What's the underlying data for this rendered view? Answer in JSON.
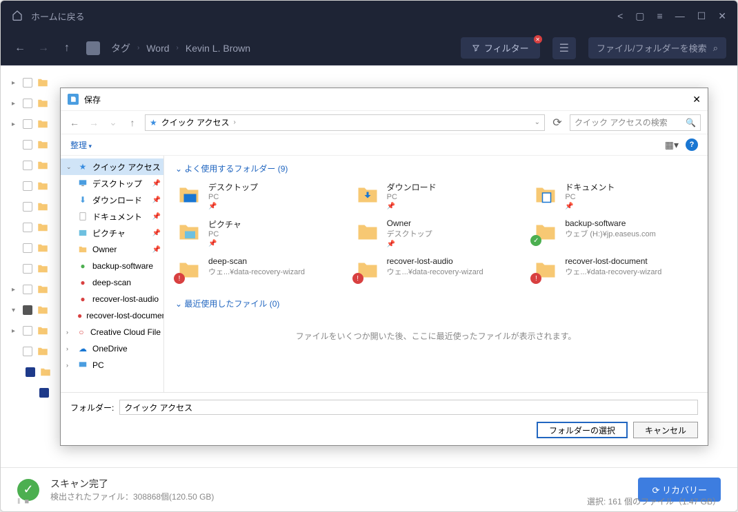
{
  "titlebar": {
    "home": "ホームに戻る"
  },
  "toolbar": {
    "tag": "タグ",
    "crumb1": "Word",
    "crumb2": "Kevin L. Brown",
    "filter": "フィルター",
    "search_placeholder": "ファイル/フォルダーを検索"
  },
  "dialog": {
    "title": "保存",
    "path": "クイック アクセス",
    "search_placeholder": "クイック アクセスの検索",
    "organize": "整理",
    "sidebar": {
      "quick_access": "クイック アクセス",
      "desktop": "デスクトップ",
      "downloads": "ダウンロード",
      "documents": "ドキュメント",
      "pictures": "ピクチャ",
      "owner": "Owner",
      "backup": "backup-software",
      "deepscan": "deep-scan",
      "recover_audio": "recover-lost-audio",
      "recover_doc": "recover-lost-document",
      "creative": "Creative Cloud File",
      "onedrive": "OneDrive",
      "pc": "PC"
    },
    "section_freq": "よく使用するフォルダー (9)",
    "section_recent": "最近使用したファイル (0)",
    "recent_empty": "ファイルをいくつか開いた後、ここに最近使ったファイルが表示されます。",
    "folders": [
      {
        "name": "デスクトップ",
        "loc": "PC",
        "pinned": true,
        "icon": "desktop"
      },
      {
        "name": "ダウンロード",
        "loc": "PC",
        "pinned": true,
        "icon": "download"
      },
      {
        "name": "ドキュメント",
        "loc": "PC",
        "pinned": true,
        "icon": "document"
      },
      {
        "name": "ピクチャ",
        "loc": "PC",
        "pinned": true,
        "icon": "picture"
      },
      {
        "name": "Owner",
        "loc": "デスクトップ",
        "pinned": true,
        "icon": "folder"
      },
      {
        "name": "backup-software",
        "loc": "ウェブ (H:)¥jp.easeus.com",
        "pinned": false,
        "icon": "folder-green"
      },
      {
        "name": "deep-scan",
        "loc": "ウェ...¥data-recovery-wizard",
        "pinned": false,
        "icon": "folder-red"
      },
      {
        "name": "recover-lost-audio",
        "loc": "ウェ...¥data-recovery-wizard",
        "pinned": false,
        "icon": "folder-red"
      },
      {
        "name": "recover-lost-document",
        "loc": "ウェ...¥data-recovery-wizard",
        "pinned": false,
        "icon": "folder-red"
      }
    ],
    "folder_label": "フォルダー:",
    "folder_value": "クイック アクセス",
    "select_btn": "フォルダーの選択",
    "cancel_btn": "キャンセル"
  },
  "status": {
    "title": "スキャン完了",
    "detail": "検出されたファイル：308868個(120.50 GB)",
    "recover": "リカバリー",
    "selection": "選択: 161 個のファイル（1.47 GB）"
  }
}
